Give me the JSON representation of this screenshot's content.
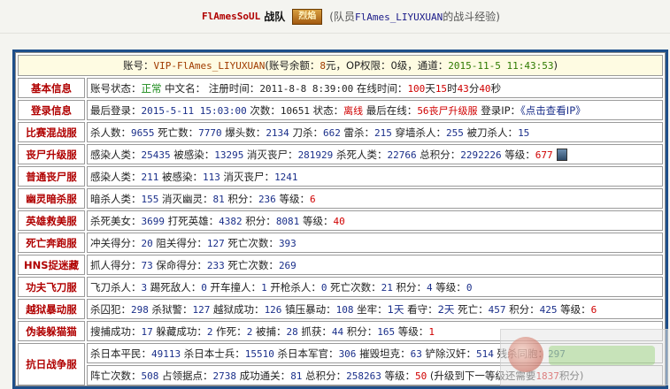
{
  "top": {
    "team_name": "FlAmesSoUL",
    "team_suffix": "战队",
    "badge_text": "烈焰",
    "caption_prefix": "(队员",
    "caption_member": "FlAmes_LIYUXUAN",
    "caption_suffix": "的战斗经验)"
  },
  "account": {
    "label_account": "账号：",
    "account": "VIP-FlAmes_LIYUXUAN",
    "label_balance": "(账号余额：",
    "balance": "8",
    "label_op": "元，OP权限：",
    "op": "0级",
    "label_channel": "，通道：",
    "time": "2015-11-5 11:43:53",
    "close": ")"
  },
  "rows": [
    {
      "label": "基本信息",
      "parts": [
        {
          "t": "账号状态："
        },
        {
          "t": "正常",
          "c": "grn"
        },
        {
          "t": "  中文名：  注册时间："
        },
        {
          "t": "2011-8-8 8:39:00",
          "c": "mono"
        },
        {
          "t": "  在线时间："
        },
        {
          "t": "100",
          "c": "red"
        },
        {
          "t": "天"
        },
        {
          "t": "15",
          "c": "red"
        },
        {
          "t": "时"
        },
        {
          "t": "43",
          "c": "red"
        },
        {
          "t": "分"
        },
        {
          "t": "40",
          "c": "red"
        },
        {
          "t": "秒"
        }
      ]
    },
    {
      "label": "登录信息",
      "parts": [
        {
          "t": "最后登录："
        },
        {
          "t": "2015-5-11 15:03:00",
          "c": "v"
        },
        {
          "t": "  次数："
        },
        {
          "t": "10651",
          "c": "mono"
        },
        {
          "t": "  状态："
        },
        {
          "t": "离线",
          "c": "red"
        },
        {
          "t": "  最后在线："
        },
        {
          "t": "56丧尸升级服",
          "c": "red"
        },
        {
          "t": "  登录IP："
        },
        {
          "t": "《点击查看IP》",
          "c": "link"
        }
      ]
    },
    {
      "label": "比赛混战服",
      "parts": [
        {
          "t": "杀人数："
        },
        {
          "t": "9655",
          "c": "v"
        },
        {
          "t": " 死亡数："
        },
        {
          "t": "7770",
          "c": "v"
        },
        {
          "t": " 爆头数："
        },
        {
          "t": "2134",
          "c": "v"
        },
        {
          "t": " 刀杀："
        },
        {
          "t": "662",
          "c": "v"
        },
        {
          "t": " 雷杀："
        },
        {
          "t": "215",
          "c": "v"
        },
        {
          "t": " 穿墙杀人："
        },
        {
          "t": "255",
          "c": "v"
        },
        {
          "t": " 被刀杀人："
        },
        {
          "t": "15",
          "c": "v"
        }
      ]
    },
    {
      "label": "丧尸升级服",
      "icon": true,
      "parts": [
        {
          "t": "感染人类："
        },
        {
          "t": "25435",
          "c": "v"
        },
        {
          "t": " 被感染："
        },
        {
          "t": "13295",
          "c": "v"
        },
        {
          "t": " 消灭丧尸："
        },
        {
          "t": "281929",
          "c": "v"
        },
        {
          "t": " 杀死人类："
        },
        {
          "t": "22766",
          "c": "v"
        },
        {
          "t": " 总积分："
        },
        {
          "t": "2292226",
          "c": "v"
        },
        {
          "t": " 等级："
        },
        {
          "t": "677",
          "c": "red"
        }
      ]
    },
    {
      "label": "普通丧尸服",
      "parts": [
        {
          "t": "感染人类："
        },
        {
          "t": "211",
          "c": "v"
        },
        {
          "t": " 被感染："
        },
        {
          "t": "113",
          "c": "v"
        },
        {
          "t": " 消灭丧尸："
        },
        {
          "t": "1241",
          "c": "v"
        }
      ]
    },
    {
      "label": "幽灵暗杀服",
      "parts": [
        {
          "t": "暗杀人类："
        },
        {
          "t": "155",
          "c": "v"
        },
        {
          "t": " 消灭幽灵："
        },
        {
          "t": "81",
          "c": "v"
        },
        {
          "t": " 积分："
        },
        {
          "t": "236",
          "c": "v"
        },
        {
          "t": " 等级："
        },
        {
          "t": "6",
          "c": "red"
        }
      ]
    },
    {
      "label": "英雄救美服",
      "parts": [
        {
          "t": "杀死美女："
        },
        {
          "t": "3699",
          "c": "v"
        },
        {
          "t": " 打死英雄："
        },
        {
          "t": "4382",
          "c": "v"
        },
        {
          "t": " 积分："
        },
        {
          "t": "8081",
          "c": "v"
        },
        {
          "t": " 等级："
        },
        {
          "t": "40",
          "c": "red"
        }
      ]
    },
    {
      "label": "死亡奔跑服",
      "parts": [
        {
          "t": "冲关得分："
        },
        {
          "t": "20",
          "c": "v"
        },
        {
          "t": " 阻关得分："
        },
        {
          "t": "127",
          "c": "v"
        },
        {
          "t": " 死亡次数："
        },
        {
          "t": "393",
          "c": "v"
        }
      ]
    },
    {
      "label": "HNS捉迷藏",
      "parts": [
        {
          "t": "抓人得分："
        },
        {
          "t": "73",
          "c": "v"
        },
        {
          "t": " 保命得分："
        },
        {
          "t": "233",
          "c": "v"
        },
        {
          "t": " 死亡次数："
        },
        {
          "t": "269",
          "c": "v"
        }
      ]
    },
    {
      "label": "功夫飞刀服",
      "parts": [
        {
          "t": "飞刀杀人："
        },
        {
          "t": "3",
          "c": "v"
        },
        {
          "t": " 踢死敌人："
        },
        {
          "t": "0",
          "c": "v"
        },
        {
          "t": " 开车撞人："
        },
        {
          "t": "1",
          "c": "v"
        },
        {
          "t": " 开枪杀人："
        },
        {
          "t": "0",
          "c": "v"
        },
        {
          "t": " 死亡次数："
        },
        {
          "t": "21",
          "c": "v"
        },
        {
          "t": " 积分："
        },
        {
          "t": "4",
          "c": "v"
        },
        {
          "t": " 等级："
        },
        {
          "t": "0",
          "c": "v"
        }
      ]
    },
    {
      "label": "越狱暴动服",
      "parts": [
        {
          "t": "杀囚犯："
        },
        {
          "t": "298",
          "c": "v"
        },
        {
          "t": " 杀狱警："
        },
        {
          "t": "127",
          "c": "v"
        },
        {
          "t": " 越狱成功："
        },
        {
          "t": "126",
          "c": "v"
        },
        {
          "t": " 镇压暴动："
        },
        {
          "t": "108",
          "c": "v"
        },
        {
          "t": " 坐牢："
        },
        {
          "t": "1天",
          "c": "blu"
        },
        {
          "t": " 看守："
        },
        {
          "t": "2天",
          "c": "blu"
        },
        {
          "t": " 死亡："
        },
        {
          "t": "457",
          "c": "v"
        },
        {
          "t": " 积分："
        },
        {
          "t": "425",
          "c": "v"
        },
        {
          "t": " 等级："
        },
        {
          "t": "6",
          "c": "red"
        }
      ]
    },
    {
      "label": "伪装躲猫猫",
      "parts": [
        {
          "t": "搜捕成功："
        },
        {
          "t": "17",
          "c": "v"
        },
        {
          "t": " 躲藏成功："
        },
        {
          "t": "2",
          "c": "v"
        },
        {
          "t": " 作死："
        },
        {
          "t": "2",
          "c": "v"
        },
        {
          "t": " 被捕："
        },
        {
          "t": "28",
          "c": "v"
        },
        {
          "t": " 抓获："
        },
        {
          "t": "44",
          "c": "v"
        },
        {
          "t": " 积分："
        },
        {
          "t": "165",
          "c": "v"
        },
        {
          "t": " 等级："
        },
        {
          "t": "1",
          "c": "red"
        }
      ]
    }
  ],
  "war": {
    "label": "抗日战争服",
    "line1": [
      {
        "t": "杀日本平民："
      },
      {
        "t": "49113",
        "c": "v"
      },
      {
        "t": " 杀日本士兵："
      },
      {
        "t": "15510",
        "c": "v"
      },
      {
        "t": " 杀日本军官："
      },
      {
        "t": "306",
        "c": "v"
      },
      {
        "t": " 摧毁坦克："
      },
      {
        "t": "63",
        "c": "v"
      },
      {
        "t": " 铲除汉奸："
      },
      {
        "t": "514",
        "c": "v"
      },
      {
        "t": " 残杀同胞："
      },
      {
        "t": "297",
        "c": "v"
      }
    ],
    "line2": [
      {
        "t": "阵亡次数："
      },
      {
        "t": "508",
        "c": "v"
      },
      {
        "t": " 占领据点："
      },
      {
        "t": "2738",
        "c": "v"
      },
      {
        "t": " 成功通关："
      },
      {
        "t": "81",
        "c": "v"
      },
      {
        "t": " 总积分："
      },
      {
        "t": "258263",
        "c": "v"
      },
      {
        "t": " 等级："
      },
      {
        "t": "50",
        "c": "red"
      },
      {
        "t": " (升级到下一等级还需要"
      },
      {
        "t": "1837",
        "c": "red"
      },
      {
        "t": "积分)"
      }
    ]
  }
}
